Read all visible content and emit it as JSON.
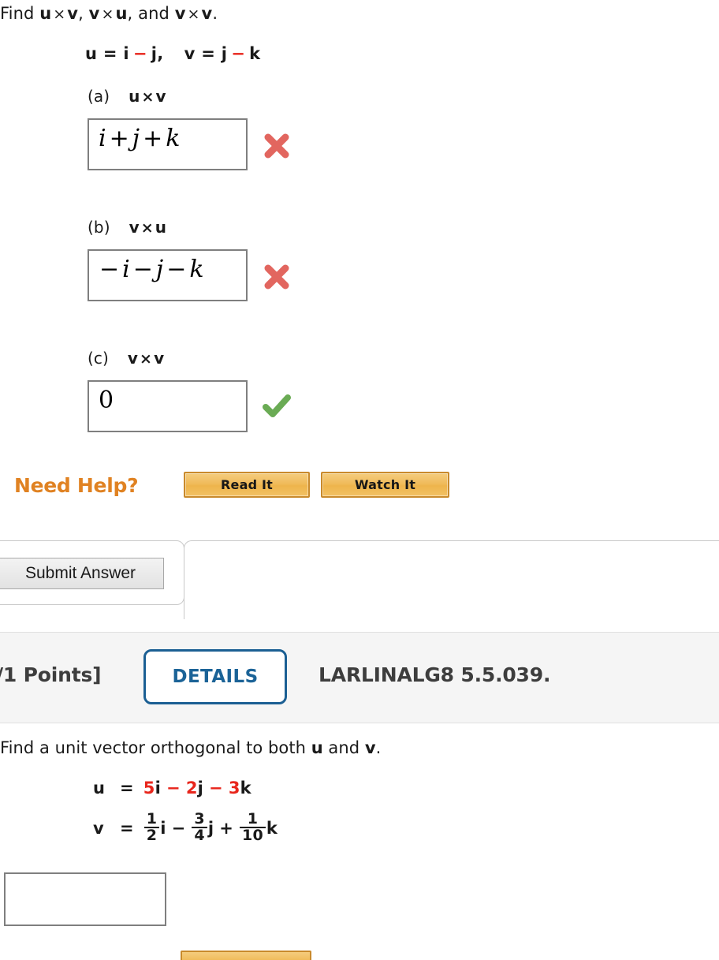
{
  "question1": {
    "prompt": {
      "lead": "Find ",
      "t1_a": "u",
      "t1_x": "×",
      "t1_b": "v",
      "sep1": ", ",
      "t2_a": "v",
      "t2_x": "×",
      "t2_b": "u",
      "sep2": ", and ",
      "t3_a": "v",
      "t3_x": "×",
      "t3_b": "v",
      "end": "."
    },
    "given": {
      "u_label": "u",
      "u_eq": " = ",
      "u_i": "i",
      "u_minus": "−",
      "u_j": "j",
      "u_comma": ",",
      "v_label": "v",
      "v_eq": " = ",
      "v_j": "j",
      "v_minus": "−",
      "v_k": "k"
    },
    "parts": [
      {
        "letter": "(a)",
        "expr_a": "u",
        "expr_x": "×",
        "expr_b": "v",
        "answer": "i + j + k",
        "answer_tokens": [
          "i",
          "+",
          "j",
          "+",
          "k"
        ],
        "status": "incorrect",
        "status_icon": "red-x-icon"
      },
      {
        "letter": "(b)",
        "expr_a": "v",
        "expr_x": "×",
        "expr_b": "u",
        "answer": "−i − j − k",
        "answer_tokens": [
          "−",
          "i",
          "−",
          "j",
          "−",
          "k"
        ],
        "status": "incorrect",
        "status_icon": "red-x-icon"
      },
      {
        "letter": "(c)",
        "expr_a": "v",
        "expr_x": "×",
        "expr_b": "v",
        "answer": "0",
        "answer_tokens": [
          "0"
        ],
        "status": "correct",
        "status_icon": "green-check-icon"
      }
    ],
    "need_help": {
      "label": "Need Help?",
      "read_it": "Read It",
      "watch_it": "Watch It"
    },
    "submit_label": "Submit Answer"
  },
  "question2": {
    "header": {
      "points": "/1 Points]",
      "details": "DETAILS",
      "problem_id": "LARLINALG8 5.5.039."
    },
    "prompt": {
      "lead": "Find a unit vector orthogonal to both ",
      "vec_u": "u",
      "mid": " and ",
      "vec_v": "v",
      "end": "."
    },
    "equations": {
      "u": {
        "label": "u",
        "eq": "=",
        "c1": "5",
        "i": "i",
        "op1": "−",
        "c2": "2",
        "j": "j",
        "op2": "−",
        "c3": "3",
        "k": "k"
      },
      "v": {
        "label": "v",
        "eq": "=",
        "f1_num": "1",
        "f1_den": "2",
        "i": "i",
        "op1": "−",
        "f2_num": "3",
        "f2_den": "4",
        "j": "j",
        "op2": "+",
        "f3_num": "1",
        "f3_den": "10",
        "k": "k"
      }
    },
    "answer_value": ""
  },
  "colors": {
    "accent_red": "#e8261c",
    "help_orange": "#e08222",
    "details_blue": "#1b6397",
    "box_border": "#7f7f7f",
    "header_bg": "#f5f5f5",
    "correct_green": "#6aab54",
    "incorrect_red": "#e2665f"
  }
}
